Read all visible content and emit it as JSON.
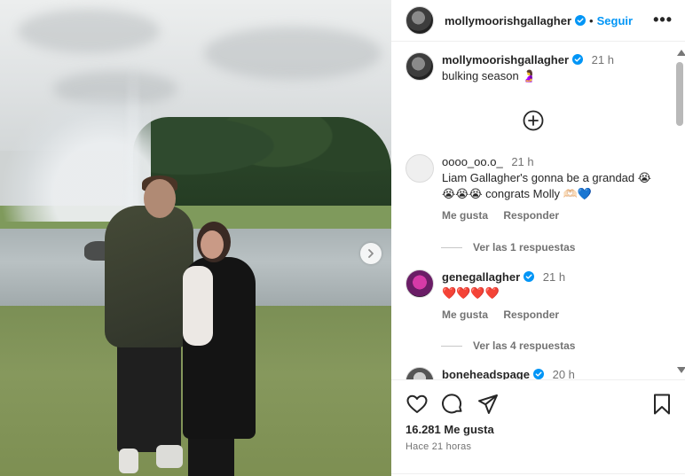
{
  "post": {
    "username": "mollymoorishgallagher",
    "follow_label": "Seguir",
    "separator": "•",
    "more_label": "•••"
  },
  "caption": {
    "username": "mollymoorishgallagher",
    "time": "21 h",
    "text": "bulking season 🤰"
  },
  "comments": [
    {
      "username": "oooo_oo.o_",
      "time": "21 h",
      "text": "Liam Gallagher's gonna be a grandad 😭😭😭😭 congrats Molly 🫶🏻💙",
      "like_label": "Me gusta",
      "reply_label": "Responder",
      "view_replies": "Ver las 1 respuestas"
    },
    {
      "username": "genegallagher",
      "time": "21 h",
      "text": "❤️❤️❤️❤️",
      "like_label": "Me gusta",
      "reply_label": "Responder",
      "view_replies": "Ver las 4 respuestas"
    },
    {
      "username": "boneheadspage",
      "time": "20 h"
    }
  ],
  "footer": {
    "likes": "16.281 Me gusta",
    "posted": "Hace 21 horas"
  },
  "colors": {
    "accent": "#0095f6",
    "verified": "#0095f6",
    "heart": "#ed4956",
    "muted": "#737373"
  }
}
